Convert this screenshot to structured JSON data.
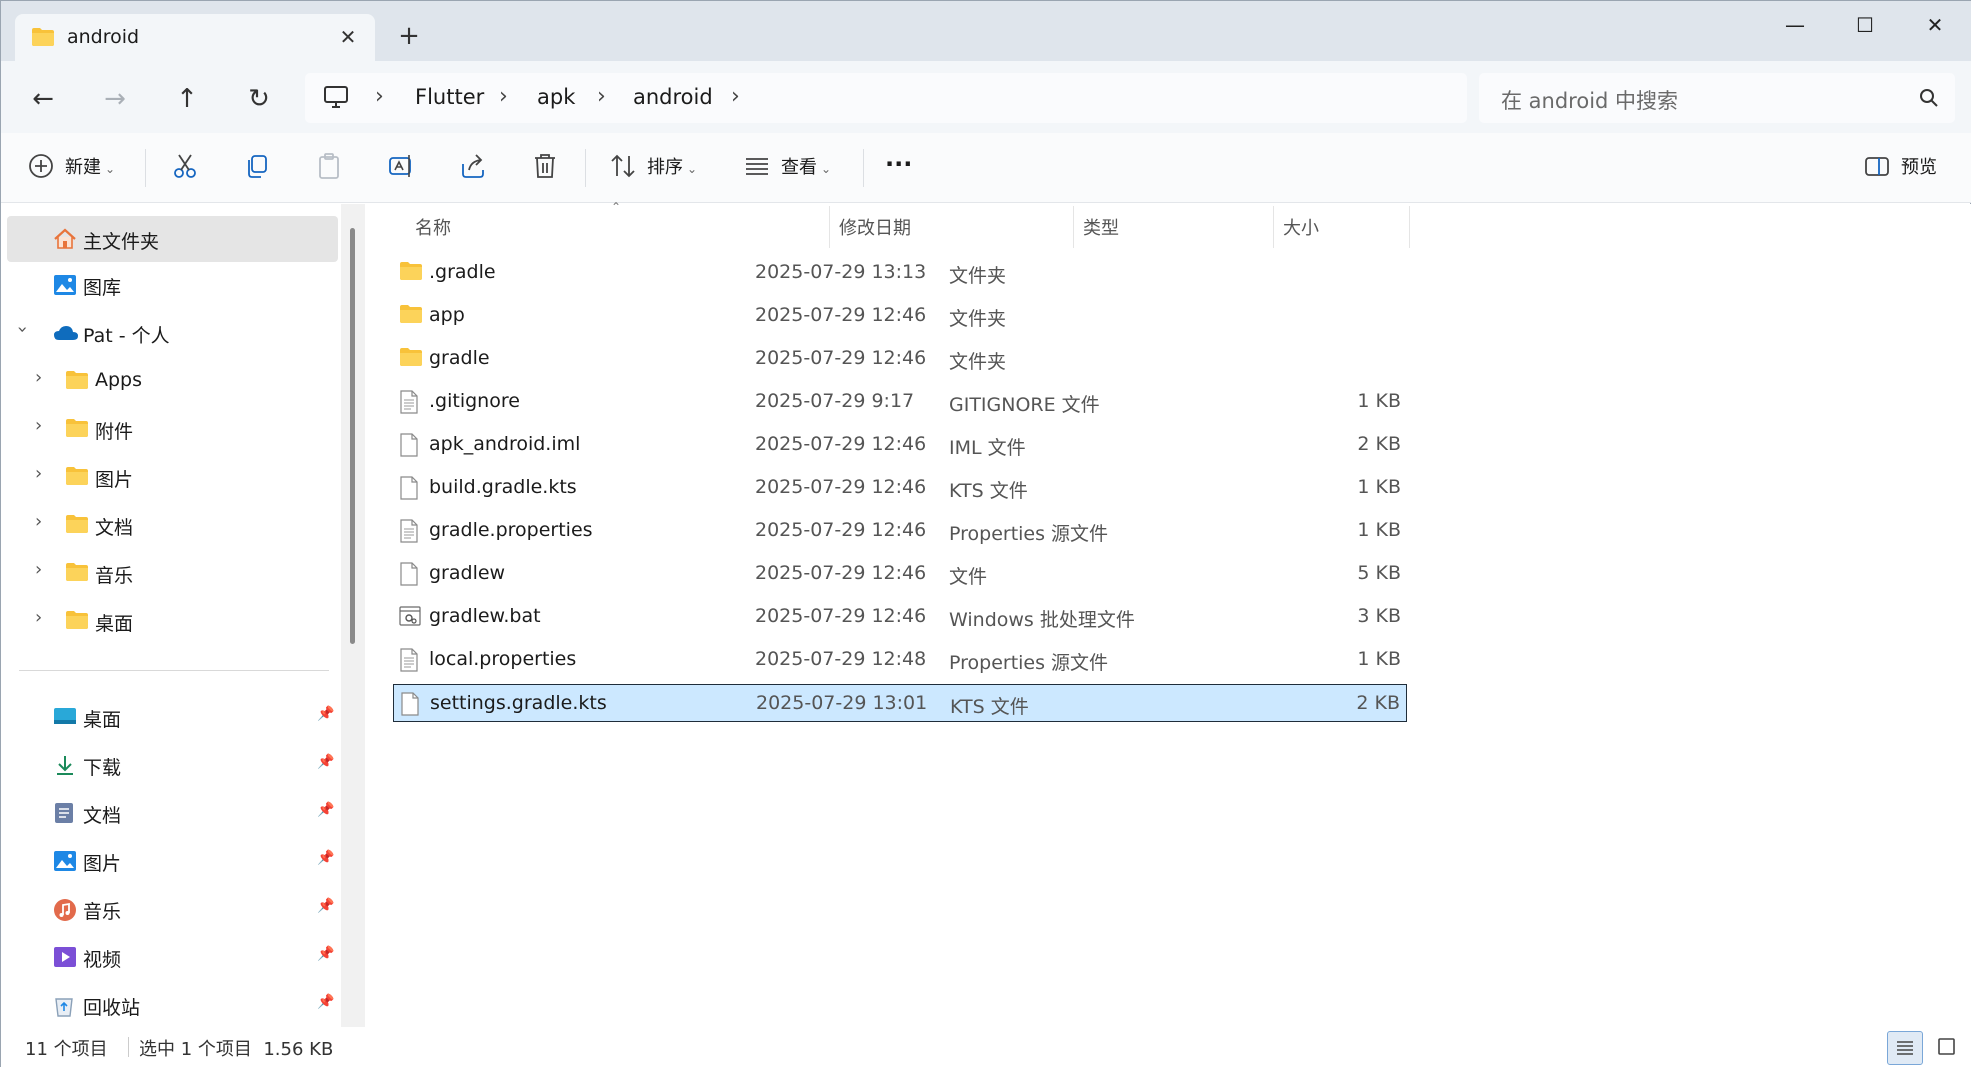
{
  "tab": {
    "title": "android",
    "close": "✕",
    "new": "+"
  },
  "window_buttons": {
    "minimize": "—",
    "maximize": "☐",
    "close": "✕"
  },
  "nav": {
    "back": "←",
    "forward": "→",
    "up": "↑",
    "refresh": "↻"
  },
  "breadcrumb": [
    "Flutter",
    "apk",
    "android"
  ],
  "breadcrumb_sep": "›",
  "search": {
    "placeholder": "在 android 中搜索"
  },
  "commands": {
    "new": "新建",
    "sort": "排序",
    "view": "查看",
    "more": "···",
    "preview": "预览"
  },
  "sidebar": {
    "top": [
      {
        "label": "主文件夹",
        "icon": "home-icon"
      },
      {
        "label": "图库",
        "icon": "gallery-icon"
      },
      {
        "label": "Pat - 个人",
        "icon": "onedrive-icon"
      }
    ],
    "cloud_folders": [
      "Apps",
      "附件",
      "图片",
      "文档",
      "音乐",
      "桌面"
    ],
    "quick_access": [
      {
        "label": "桌面",
        "icon": "desktop-icon"
      },
      {
        "label": "下载",
        "icon": "download-icon"
      },
      {
        "label": "文档",
        "icon": "documents-icon"
      },
      {
        "label": "图片",
        "icon": "pictures-icon"
      },
      {
        "label": "音乐",
        "icon": "music-icon"
      },
      {
        "label": "视频",
        "icon": "videos-icon"
      },
      {
        "label": "回收站",
        "icon": "recycle-bin-icon"
      }
    ]
  },
  "columns": {
    "name": "名称",
    "date": "修改日期",
    "type": "类型",
    "size": "大小"
  },
  "files": [
    {
      "name": ".gradle",
      "date": "2025-07-29 13:13",
      "type": "文件夹",
      "size": "",
      "icon": "folder-icon"
    },
    {
      "name": "app",
      "date": "2025-07-29 12:46",
      "type": "文件夹",
      "size": "",
      "icon": "folder-icon"
    },
    {
      "name": "gradle",
      "date": "2025-07-29 12:46",
      "type": "文件夹",
      "size": "",
      "icon": "folder-icon"
    },
    {
      "name": ".gitignore",
      "date": "2025-07-29 9:17",
      "type": "GITIGNORE 文件",
      "size": "1 KB",
      "icon": "text-file-icon"
    },
    {
      "name": "apk_android.iml",
      "date": "2025-07-29 12:46",
      "type": "IML 文件",
      "size": "2 KB",
      "icon": "file-icon"
    },
    {
      "name": "build.gradle.kts",
      "date": "2025-07-29 12:46",
      "type": "KTS 文件",
      "size": "1 KB",
      "icon": "file-icon"
    },
    {
      "name": "gradle.properties",
      "date": "2025-07-29 12:46",
      "type": "Properties 源文件",
      "size": "1 KB",
      "icon": "text-file-icon"
    },
    {
      "name": "gradlew",
      "date": "2025-07-29 12:46",
      "type": "文件",
      "size": "5 KB",
      "icon": "file-icon"
    },
    {
      "name": "gradlew.bat",
      "date": "2025-07-29 12:46",
      "type": "Windows 批处理文件",
      "size": "3 KB",
      "icon": "batch-file-icon"
    },
    {
      "name": "local.properties",
      "date": "2025-07-29 12:48",
      "type": "Properties 源文件",
      "size": "1 KB",
      "icon": "text-file-icon"
    },
    {
      "name": "settings.gradle.kts",
      "date": "2025-07-29 13:01",
      "type": "KTS 文件",
      "size": "2 KB",
      "icon": "file-icon",
      "selected": true
    }
  ],
  "status": {
    "count": "11 个项目",
    "selection": "选中 1 个项目  1.56 KB"
  },
  "colors": {
    "accent": "#0067c0",
    "selection": "#cce8ff",
    "folder": "#f8c23a"
  }
}
